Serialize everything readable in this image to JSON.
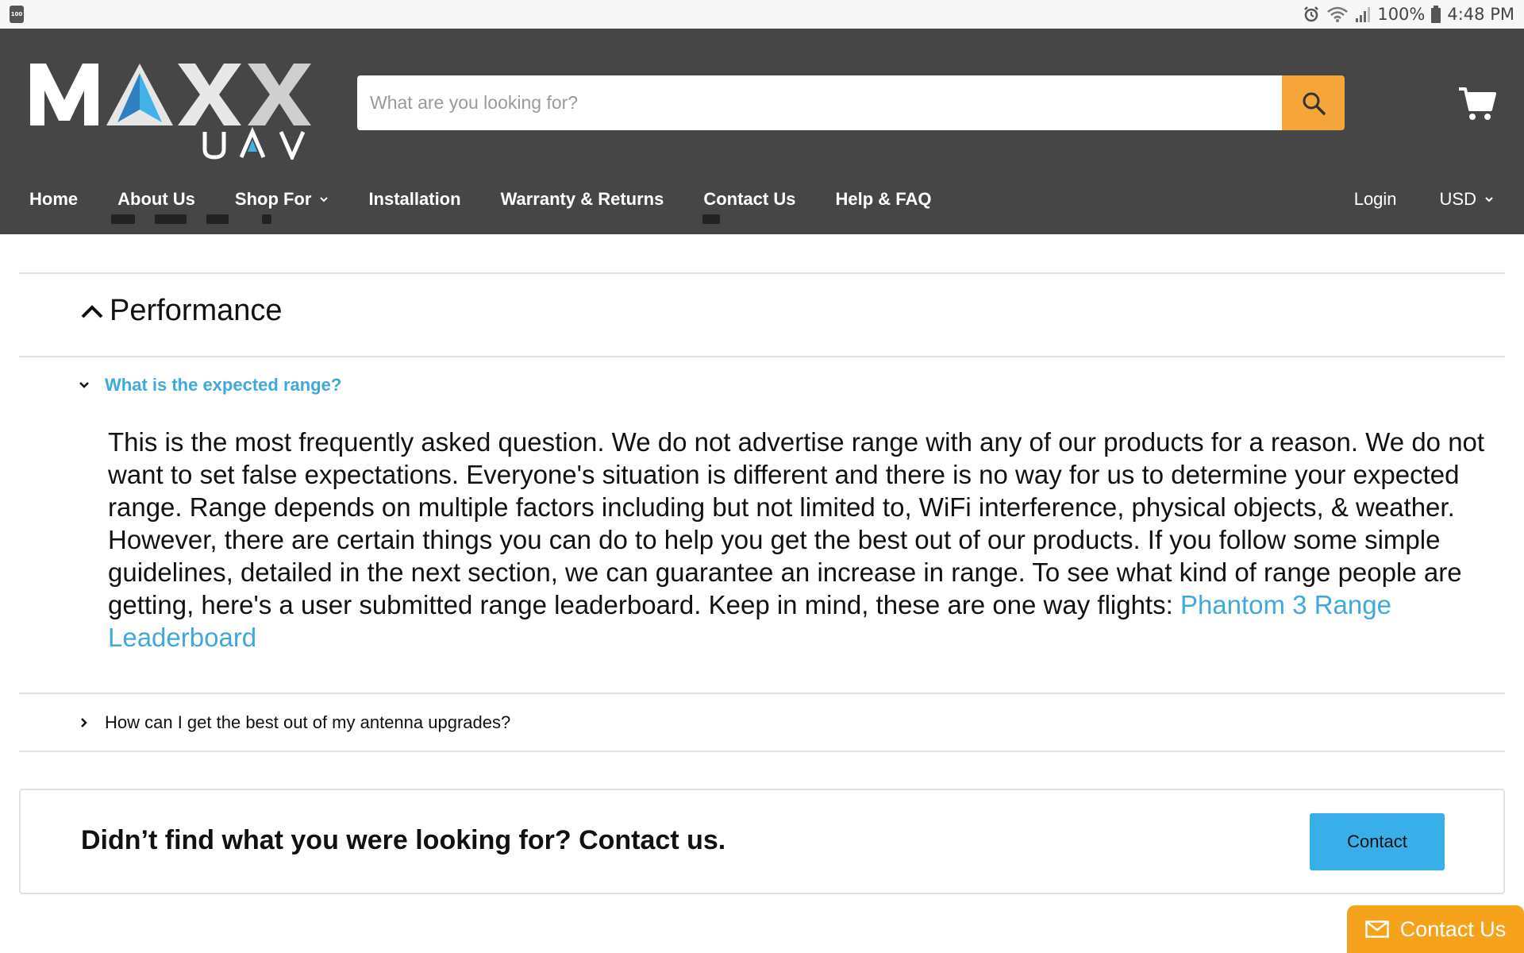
{
  "status_bar": {
    "battery_level": "100%",
    "time": "4:48 PM",
    "small_battery_label": "100"
  },
  "header": {
    "logo_text": "MAXX",
    "logo_subtext": "UAV",
    "search_placeholder": "What are you looking for?",
    "accent_color": "#f5a53a",
    "background_color": "#464646"
  },
  "nav": {
    "items": [
      {
        "label": "Home"
      },
      {
        "label": "About Us"
      },
      {
        "label": "Shop For",
        "has_dropdown": true
      },
      {
        "label": "Installation"
      },
      {
        "label": "Warranty & Returns"
      },
      {
        "label": "Contact Us"
      },
      {
        "label": "Help & FAQ"
      }
    ],
    "login_label": "Login",
    "currency_label": "USD"
  },
  "faq": {
    "section_title": "Performance",
    "questions": [
      {
        "question": "What is the expected range?",
        "open": true,
        "answer": "This is the most frequently asked question. We do not advertise range with any of our products for a reason. We do not want to set false expectations. Everyone's situation is different and there is no way for us to determine your expected range. Range depends on multiple factors including but not limited to, WiFi interference, physical objects, & weather. However, there are certain things you can do to help you get the best out of our products. If you follow some simple guidelines, detailed in the next section, we can guarantee an increase in range. To see what kind of range people are getting, here's a user submitted range leaderboard. Keep in mind, these are one way flights: ",
        "link_text": "Phantom 3 Range Leaderboard"
      },
      {
        "question": "How can I get the best out of my antenna upgrades?",
        "open": false
      }
    ]
  },
  "contact_box": {
    "text": "Didn’t find what you were looking for? Contact us.",
    "button_label": "Contact"
  },
  "floating_contact": {
    "label": "Contact Us",
    "color": "#f7a21b"
  },
  "link_color": "#3fa9dc"
}
